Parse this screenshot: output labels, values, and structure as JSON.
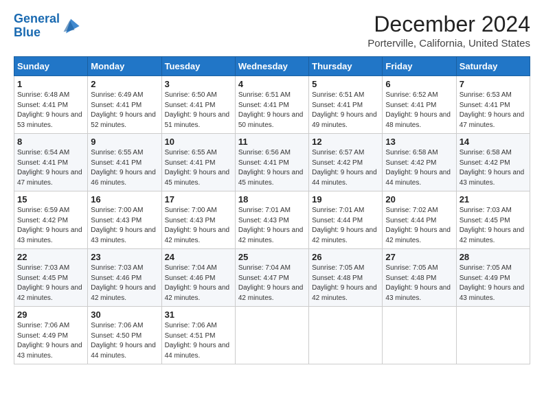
{
  "header": {
    "logo_line1": "General",
    "logo_line2": "Blue",
    "main_title": "December 2024",
    "subtitle": "Porterville, California, United States"
  },
  "calendar": {
    "days_of_week": [
      "Sunday",
      "Monday",
      "Tuesday",
      "Wednesday",
      "Thursday",
      "Friday",
      "Saturday"
    ],
    "weeks": [
      [
        {
          "day": "1",
          "info": "Sunrise: 6:48 AM\nSunset: 4:41 PM\nDaylight: 9 hours and 53 minutes."
        },
        {
          "day": "2",
          "info": "Sunrise: 6:49 AM\nSunset: 4:41 PM\nDaylight: 9 hours and 52 minutes."
        },
        {
          "day": "3",
          "info": "Sunrise: 6:50 AM\nSunset: 4:41 PM\nDaylight: 9 hours and 51 minutes."
        },
        {
          "day": "4",
          "info": "Sunrise: 6:51 AM\nSunset: 4:41 PM\nDaylight: 9 hours and 50 minutes."
        },
        {
          "day": "5",
          "info": "Sunrise: 6:51 AM\nSunset: 4:41 PM\nDaylight: 9 hours and 49 minutes."
        },
        {
          "day": "6",
          "info": "Sunrise: 6:52 AM\nSunset: 4:41 PM\nDaylight: 9 hours and 48 minutes."
        },
        {
          "day": "7",
          "info": "Sunrise: 6:53 AM\nSunset: 4:41 PM\nDaylight: 9 hours and 47 minutes."
        }
      ],
      [
        {
          "day": "8",
          "info": "Sunrise: 6:54 AM\nSunset: 4:41 PM\nDaylight: 9 hours and 47 minutes."
        },
        {
          "day": "9",
          "info": "Sunrise: 6:55 AM\nSunset: 4:41 PM\nDaylight: 9 hours and 46 minutes."
        },
        {
          "day": "10",
          "info": "Sunrise: 6:55 AM\nSunset: 4:41 PM\nDaylight: 9 hours and 45 minutes."
        },
        {
          "day": "11",
          "info": "Sunrise: 6:56 AM\nSunset: 4:41 PM\nDaylight: 9 hours and 45 minutes."
        },
        {
          "day": "12",
          "info": "Sunrise: 6:57 AM\nSunset: 4:42 PM\nDaylight: 9 hours and 44 minutes."
        },
        {
          "day": "13",
          "info": "Sunrise: 6:58 AM\nSunset: 4:42 PM\nDaylight: 9 hours and 44 minutes."
        },
        {
          "day": "14",
          "info": "Sunrise: 6:58 AM\nSunset: 4:42 PM\nDaylight: 9 hours and 43 minutes."
        }
      ],
      [
        {
          "day": "15",
          "info": "Sunrise: 6:59 AM\nSunset: 4:42 PM\nDaylight: 9 hours and 43 minutes."
        },
        {
          "day": "16",
          "info": "Sunrise: 7:00 AM\nSunset: 4:43 PM\nDaylight: 9 hours and 43 minutes."
        },
        {
          "day": "17",
          "info": "Sunrise: 7:00 AM\nSunset: 4:43 PM\nDaylight: 9 hours and 42 minutes."
        },
        {
          "day": "18",
          "info": "Sunrise: 7:01 AM\nSunset: 4:43 PM\nDaylight: 9 hours and 42 minutes."
        },
        {
          "day": "19",
          "info": "Sunrise: 7:01 AM\nSunset: 4:44 PM\nDaylight: 9 hours and 42 minutes."
        },
        {
          "day": "20",
          "info": "Sunrise: 7:02 AM\nSunset: 4:44 PM\nDaylight: 9 hours and 42 minutes."
        },
        {
          "day": "21",
          "info": "Sunrise: 7:03 AM\nSunset: 4:45 PM\nDaylight: 9 hours and 42 minutes."
        }
      ],
      [
        {
          "day": "22",
          "info": "Sunrise: 7:03 AM\nSunset: 4:45 PM\nDaylight: 9 hours and 42 minutes."
        },
        {
          "day": "23",
          "info": "Sunrise: 7:03 AM\nSunset: 4:46 PM\nDaylight: 9 hours and 42 minutes."
        },
        {
          "day": "24",
          "info": "Sunrise: 7:04 AM\nSunset: 4:46 PM\nDaylight: 9 hours and 42 minutes."
        },
        {
          "day": "25",
          "info": "Sunrise: 7:04 AM\nSunset: 4:47 PM\nDaylight: 9 hours and 42 minutes."
        },
        {
          "day": "26",
          "info": "Sunrise: 7:05 AM\nSunset: 4:48 PM\nDaylight: 9 hours and 42 minutes."
        },
        {
          "day": "27",
          "info": "Sunrise: 7:05 AM\nSunset: 4:48 PM\nDaylight: 9 hours and 43 minutes."
        },
        {
          "day": "28",
          "info": "Sunrise: 7:05 AM\nSunset: 4:49 PM\nDaylight: 9 hours and 43 minutes."
        }
      ],
      [
        {
          "day": "29",
          "info": "Sunrise: 7:06 AM\nSunset: 4:49 PM\nDaylight: 9 hours and 43 minutes."
        },
        {
          "day": "30",
          "info": "Sunrise: 7:06 AM\nSunset: 4:50 PM\nDaylight: 9 hours and 44 minutes."
        },
        {
          "day": "31",
          "info": "Sunrise: 7:06 AM\nSunset: 4:51 PM\nDaylight: 9 hours and 44 minutes."
        },
        null,
        null,
        null,
        null
      ]
    ]
  }
}
